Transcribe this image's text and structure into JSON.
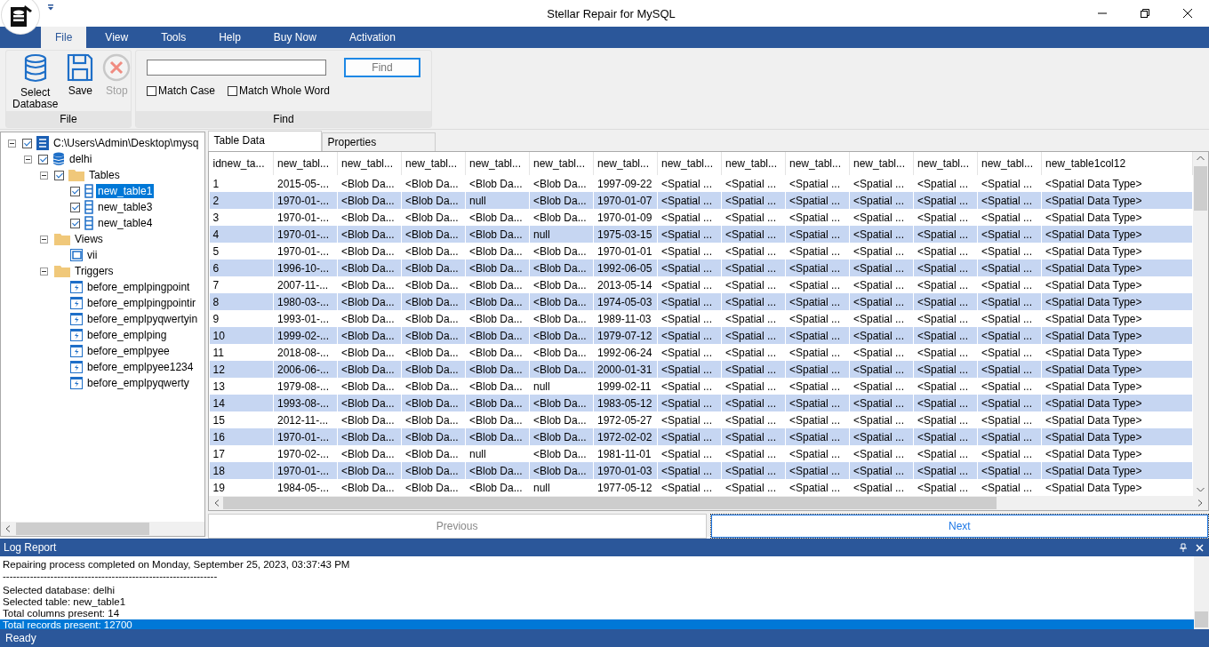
{
  "window": {
    "title": "Stellar Repair for MySQL"
  },
  "menu": [
    {
      "label": "File",
      "selected": true
    },
    {
      "label": "View",
      "selected": false
    },
    {
      "label": "Tools",
      "selected": false
    },
    {
      "label": "Help",
      "selected": false
    },
    {
      "label": "Buy Now",
      "selected": false
    },
    {
      "label": "Activation",
      "selected": false
    }
  ],
  "ribbon": {
    "file_group": {
      "label": "File",
      "buttons": [
        {
          "label": "Select Database",
          "kind": "database",
          "disabled": false
        },
        {
          "label": "Save",
          "kind": "save",
          "disabled": false
        },
        {
          "label": "Stop",
          "kind": "stop",
          "disabled": true
        }
      ]
    },
    "find_group": {
      "label": "Find",
      "button": "Find",
      "options": [
        {
          "label": "Match Case",
          "checked": false
        },
        {
          "label": "Match Whole Word",
          "checked": false
        }
      ]
    }
  },
  "tree": [
    {
      "label": "C:\\Users\\Admin\\Desktop\\mysq",
      "kind": "server",
      "checked": true,
      "expanded": true,
      "selected": false,
      "children": [
        {
          "label": "delhi",
          "kind": "database",
          "checked": true,
          "expanded": true,
          "selected": false,
          "children": [
            {
              "label": "Tables",
              "kind": "folder",
              "checked": true,
              "expanded": true,
              "selected": false,
              "children": [
                {
                  "label": "new_table1",
                  "kind": "table",
                  "checked": true,
                  "selected": true
                },
                {
                  "label": "new_table3",
                  "kind": "table",
                  "checked": true,
                  "selected": false
                },
                {
                  "label": "new_table4",
                  "kind": "table",
                  "checked": true,
                  "selected": false
                }
              ]
            },
            {
              "label": "Views",
              "kind": "folder",
              "expanded": true,
              "selected": false,
              "children": [
                {
                  "label": "vii",
                  "kind": "view",
                  "selected": false
                }
              ]
            },
            {
              "label": "Triggers",
              "kind": "folder",
              "expanded": true,
              "selected": false,
              "children": [
                {
                  "label": "before_emplpingpoint",
                  "kind": "trigger",
                  "selected": false
                },
                {
                  "label": "before_emplpingpointir",
                  "kind": "trigger",
                  "selected": false
                },
                {
                  "label": "before_emplpyqwertyin",
                  "kind": "trigger",
                  "selected": false
                },
                {
                  "label": "before_emplping",
                  "kind": "trigger",
                  "selected": false
                },
                {
                  "label": "before_emplpyee",
                  "kind": "trigger",
                  "selected": false
                },
                {
                  "label": "before_emplpyee1234",
                  "kind": "trigger",
                  "selected": false
                },
                {
                  "label": "before_emplpyqwerty",
                  "kind": "trigger",
                  "selected": false
                }
              ]
            }
          ]
        }
      ]
    }
  ],
  "tabs": [
    {
      "label": "Table Data",
      "selected": true
    },
    {
      "label": "Properties",
      "selected": false
    }
  ],
  "table": {
    "columns": [
      "idnew_ta...",
      "new_tabl...",
      "new_tabl...",
      "new_tabl...",
      "new_tabl...",
      "new_tabl...",
      "new_tabl...",
      "new_tabl...",
      "new_tabl...",
      "new_tabl...",
      "new_tabl...",
      "new_tabl...",
      "new_tabl...",
      "new_table1col12"
    ],
    "rows": [
      [
        "1",
        "2015-05-...",
        "<Blob Da...",
        "<Blob Da...",
        "<Blob Da...",
        "<Blob Da...",
        "1997-09-22",
        "<Spatial ...",
        "<Spatial ...",
        "<Spatial ...",
        "<Spatial ...",
        "<Spatial ...",
        "<Spatial ...",
        "<Spatial Data Type>"
      ],
      [
        "2",
        "1970-01-...",
        "<Blob Da...",
        "<Blob Da...",
        "null",
        "<Blob Da...",
        "1970-01-07",
        "<Spatial ...",
        "<Spatial ...",
        "<Spatial ...",
        "<Spatial ...",
        "<Spatial ...",
        "<Spatial ...",
        "<Spatial Data Type>"
      ],
      [
        "3",
        "1970-01-...",
        "<Blob Da...",
        "<Blob Da...",
        "<Blob Da...",
        "<Blob Da...",
        "1970-01-09",
        "<Spatial ...",
        "<Spatial ...",
        "<Spatial ...",
        "<Spatial ...",
        "<Spatial ...",
        "<Spatial ...",
        "<Spatial Data Type>"
      ],
      [
        "4",
        "1970-01-...",
        "<Blob Da...",
        "<Blob Da...",
        "<Blob Da...",
        "null",
        "1975-03-15",
        "<Spatial ...",
        "<Spatial ...",
        "<Spatial ...",
        "<Spatial ...",
        "<Spatial ...",
        "<Spatial ...",
        "<Spatial Data Type>"
      ],
      [
        "5",
        "1970-01-...",
        "<Blob Da...",
        "<Blob Da...",
        "<Blob Da...",
        "<Blob Da...",
        "1970-01-01",
        "<Spatial ...",
        "<Spatial ...",
        "<Spatial ...",
        "<Spatial ...",
        "<Spatial ...",
        "<Spatial ...",
        "<Spatial Data Type>"
      ],
      [
        "6",
        "1996-10-...",
        "<Blob Da...",
        "<Blob Da...",
        "<Blob Da...",
        "<Blob Da...",
        "1992-06-05",
        "<Spatial ...",
        "<Spatial ...",
        "<Spatial ...",
        "<Spatial ...",
        "<Spatial ...",
        "<Spatial ...",
        "<Spatial Data Type>"
      ],
      [
        "7",
        "2007-11-...",
        "<Blob Da...",
        "<Blob Da...",
        "<Blob Da...",
        "<Blob Da...",
        "2013-05-14",
        "<Spatial ...",
        "<Spatial ...",
        "<Spatial ...",
        "<Spatial ...",
        "<Spatial ...",
        "<Spatial ...",
        "<Spatial Data Type>"
      ],
      [
        "8",
        "1980-03-...",
        "<Blob Da...",
        "<Blob Da...",
        "<Blob Da...",
        "<Blob Da...",
        "1974-05-03",
        "<Spatial ...",
        "<Spatial ...",
        "<Spatial ...",
        "<Spatial ...",
        "<Spatial ...",
        "<Spatial ...",
        "<Spatial Data Type>"
      ],
      [
        "9",
        "1993-01-...",
        "<Blob Da...",
        "<Blob Da...",
        "<Blob Da...",
        "<Blob Da...",
        "1989-11-03",
        "<Spatial ...",
        "<Spatial ...",
        "<Spatial ...",
        "<Spatial ...",
        "<Spatial ...",
        "<Spatial ...",
        "<Spatial Data Type>"
      ],
      [
        "10",
        "1999-02-...",
        "<Blob Da...",
        "<Blob Da...",
        "<Blob Da...",
        "<Blob Da...",
        "1979-07-12",
        "<Spatial ...",
        "<Spatial ...",
        "<Spatial ...",
        "<Spatial ...",
        "<Spatial ...",
        "<Spatial ...",
        "<Spatial Data Type>"
      ],
      [
        "11",
        "2018-08-...",
        "<Blob Da...",
        "<Blob Da...",
        "<Blob Da...",
        "<Blob Da...",
        "1992-06-24",
        "<Spatial ...",
        "<Spatial ...",
        "<Spatial ...",
        "<Spatial ...",
        "<Spatial ...",
        "<Spatial ...",
        "<Spatial Data Type>"
      ],
      [
        "12",
        "2006-06-...",
        "<Blob Da...",
        "<Blob Da...",
        "<Blob Da...",
        "<Blob Da...",
        "2000-01-31",
        "<Spatial ...",
        "<Spatial ...",
        "<Spatial ...",
        "<Spatial ...",
        "<Spatial ...",
        "<Spatial ...",
        "<Spatial Data Type>"
      ],
      [
        "13",
        "1979-08-...",
        "<Blob Da...",
        "<Blob Da...",
        "<Blob Da...",
        "null",
        "1999-02-11",
        "<Spatial ...",
        "<Spatial ...",
        "<Spatial ...",
        "<Spatial ...",
        "<Spatial ...",
        "<Spatial ...",
        "<Spatial Data Type>"
      ],
      [
        "14",
        "1993-08-...",
        "<Blob Da...",
        "<Blob Da...",
        "<Blob Da...",
        "<Blob Da...",
        "1983-05-12",
        "<Spatial ...",
        "<Spatial ...",
        "<Spatial ...",
        "<Spatial ...",
        "<Spatial ...",
        "<Spatial ...",
        "<Spatial Data Type>"
      ],
      [
        "15",
        "2012-11-...",
        "<Blob Da...",
        "<Blob Da...",
        "<Blob Da...",
        "<Blob Da...",
        "1972-05-27",
        "<Spatial ...",
        "<Spatial ...",
        "<Spatial ...",
        "<Spatial ...",
        "<Spatial ...",
        "<Spatial ...",
        "<Spatial Data Type>"
      ],
      [
        "16",
        "1970-01-...",
        "<Blob Da...",
        "<Blob Da...",
        "<Blob Da...",
        "<Blob Da...",
        "1972-02-02",
        "<Spatial ...",
        "<Spatial ...",
        "<Spatial ...",
        "<Spatial ...",
        "<Spatial ...",
        "<Spatial ...",
        "<Spatial Data Type>"
      ],
      [
        "17",
        "1970-02-...",
        "<Blob Da...",
        "<Blob Da...",
        "null",
        "<Blob Da...",
        "1981-11-01",
        "<Spatial ...",
        "<Spatial ...",
        "<Spatial ...",
        "<Spatial ...",
        "<Spatial ...",
        "<Spatial ...",
        "<Spatial Data Type>"
      ],
      [
        "18",
        "1970-01-...",
        "<Blob Da...",
        "<Blob Da...",
        "<Blob Da...",
        "<Blob Da...",
        "1970-01-03",
        "<Spatial ...",
        "<Spatial ...",
        "<Spatial ...",
        "<Spatial ...",
        "<Spatial ...",
        "<Spatial ...",
        "<Spatial Data Type>"
      ],
      [
        "19",
        "1984-05-...",
        "<Blob Da...",
        "<Blob Da...",
        "<Blob Da...",
        "null",
        "1977-05-12",
        "<Spatial ...",
        "<Spatial ...",
        "<Spatial ...",
        "<Spatial ...",
        "<Spatial ...",
        "<Spatial ...",
        "<Spatial Data Type>"
      ]
    ]
  },
  "pager": [
    {
      "label": "Previous",
      "disabled": true
    },
    {
      "label": "Next",
      "disabled": false
    }
  ],
  "log": {
    "title": "Log Report",
    "lines": [
      {
        "text": "Repairing process completed on Monday, September 25, 2023, 03:37:43 PM",
        "selected": false
      },
      {
        "text": "---------------------------------------------------------------",
        "selected": false
      },
      {
        "text": "Selected database: delhi",
        "selected": false
      },
      {
        "text": "Selected table: new_table1",
        "selected": false
      },
      {
        "text": "Total columns present: 14",
        "selected": false
      },
      {
        "text": "Total records present: 12700",
        "selected": true
      }
    ]
  },
  "status_bar": "Ready"
}
